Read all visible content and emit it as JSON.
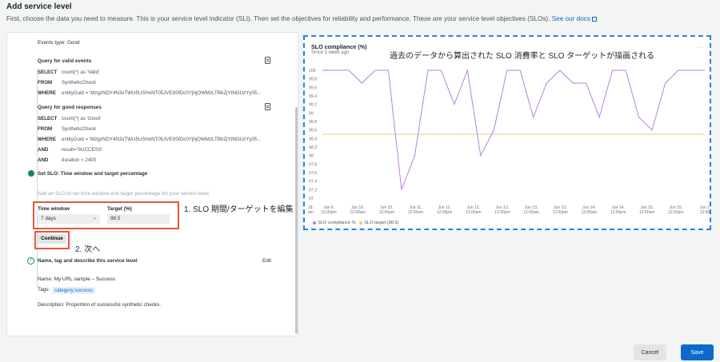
{
  "header": {
    "title": "Add service level",
    "subtitle": "First, choose the data you need to measure. This is your service level indicator (SLI). Then set the objectives for reliability and performance. These are your service level objectives (SLOs).",
    "docs_link": "See our docs"
  },
  "sli": {
    "events_type": "Events type: Good",
    "valid_heading": "Query for valid events",
    "valid_rows": [
      {
        "kw": "SELECT",
        "val": "count(*) as 'Valid'"
      },
      {
        "kw": "FROM",
        "val": "SyntheticCheck"
      },
      {
        "kw": "WHERE",
        "val": "entityGuid = 'MzgzNDY4N3xTWU5USHxNT05JVE9SfDc0YjhjOWMzLTBhZjYtNGUzYy05..."
      }
    ],
    "good_heading": "Query for good responses",
    "good_rows": [
      {
        "kw": "SELECT",
        "val": "count(*) as 'Good'"
      },
      {
        "kw": "FROM",
        "val": "SyntheticCheck"
      },
      {
        "kw": "WHERE",
        "val": "entityGuid = 'MzgzNDY4N3xTWU5USHxNT05JVE9SfDc0YjhjOWMzLTBhZjYtNGUzYy05..."
      },
      {
        "kw": "AND",
        "val": "result='SUCCESS'"
      },
      {
        "kw": "AND",
        "val": "duration < 2400"
      }
    ]
  },
  "slo": {
    "step_title": "Set SLO: Time window and target percentage",
    "helper": "Add an SLO to set time window and target percentage for your service level.",
    "time_window_label": "Time window",
    "time_window_value": "7 days",
    "target_label": "Target (%)",
    "target_value": "98.5",
    "continue_label": "Continue",
    "annotation_1": "1. SLO 期間/ターゲットを編集",
    "annotation_2": "2. 次へ"
  },
  "name_step": {
    "title": "Name, tag and describe this service level",
    "edit_label": "Edit",
    "name_line": "Name: My URL sample – Success",
    "tags_label": "Tags:",
    "tag": "category:success",
    "description": "Description: Proportion of successful synthetic checks."
  },
  "chart_data": {
    "type": "line",
    "title": "SLO compliance (%)",
    "subtitle": "Since 1 week ago",
    "annotation": "過去のデータから算出された SLO 消費率と SLO ターゲットが描画される",
    "y_ticks": [
      "100",
      "99.8",
      "99.6",
      "99.4",
      "99.2",
      "99",
      "98.8",
      "98.6",
      "98.4",
      "98.2",
      "98",
      "97.8",
      "97.6",
      "97.4",
      "97.2",
      "97"
    ],
    "ylim": [
      97,
      100
    ],
    "x_ticks": [
      [
        "Jun 9,",
        "12:00pm"
      ],
      [
        "Jun 10,",
        "12:00am"
      ],
      [
        "Jun 10,",
        "12:00pm"
      ],
      [
        "Jun 11,",
        "12:00am"
      ],
      [
        "Jun 11,",
        "12:00pm"
      ],
      [
        "Jun 12,",
        "12:00am"
      ],
      [
        "Jun 12,",
        "12:00pm"
      ],
      [
        "Jun 13,",
        "12:00am"
      ],
      [
        "Jun 13,",
        "12:00pm"
      ],
      [
        "Jun 14,",
        "12:00am"
      ],
      [
        "Jun 14,",
        "12:00pm"
      ],
      [
        "Jun 15,",
        "12:00am"
      ],
      [
        "Jun 15,",
        "12:00pm"
      ],
      [
        "Jun 1",
        "12:00"
      ]
    ],
    "x_first_partial": [
      "29,",
      "am"
    ],
    "series": [
      {
        "name": "SLO compliance %",
        "color": "#b57ee6",
        "values": [
          100,
          100,
          100,
          99.7,
          100,
          100,
          97.2,
          98,
          100,
          100,
          99.2,
          100,
          98,
          98.6,
          100,
          100,
          98.9,
          99.7,
          100,
          99.7,
          99.7,
          98.9,
          100,
          100,
          98.9,
          98.6,
          99.7,
          100,
          100,
          100
        ]
      },
      {
        "name": "SLO target (98.5)",
        "color": "#f2c46d",
        "values": [
          98.5
        ]
      }
    ],
    "legend": [
      "SLO compliance %",
      "SLO target (98.5)"
    ]
  },
  "footer": {
    "cancel_label": "Cancel",
    "save_label": "Save"
  }
}
